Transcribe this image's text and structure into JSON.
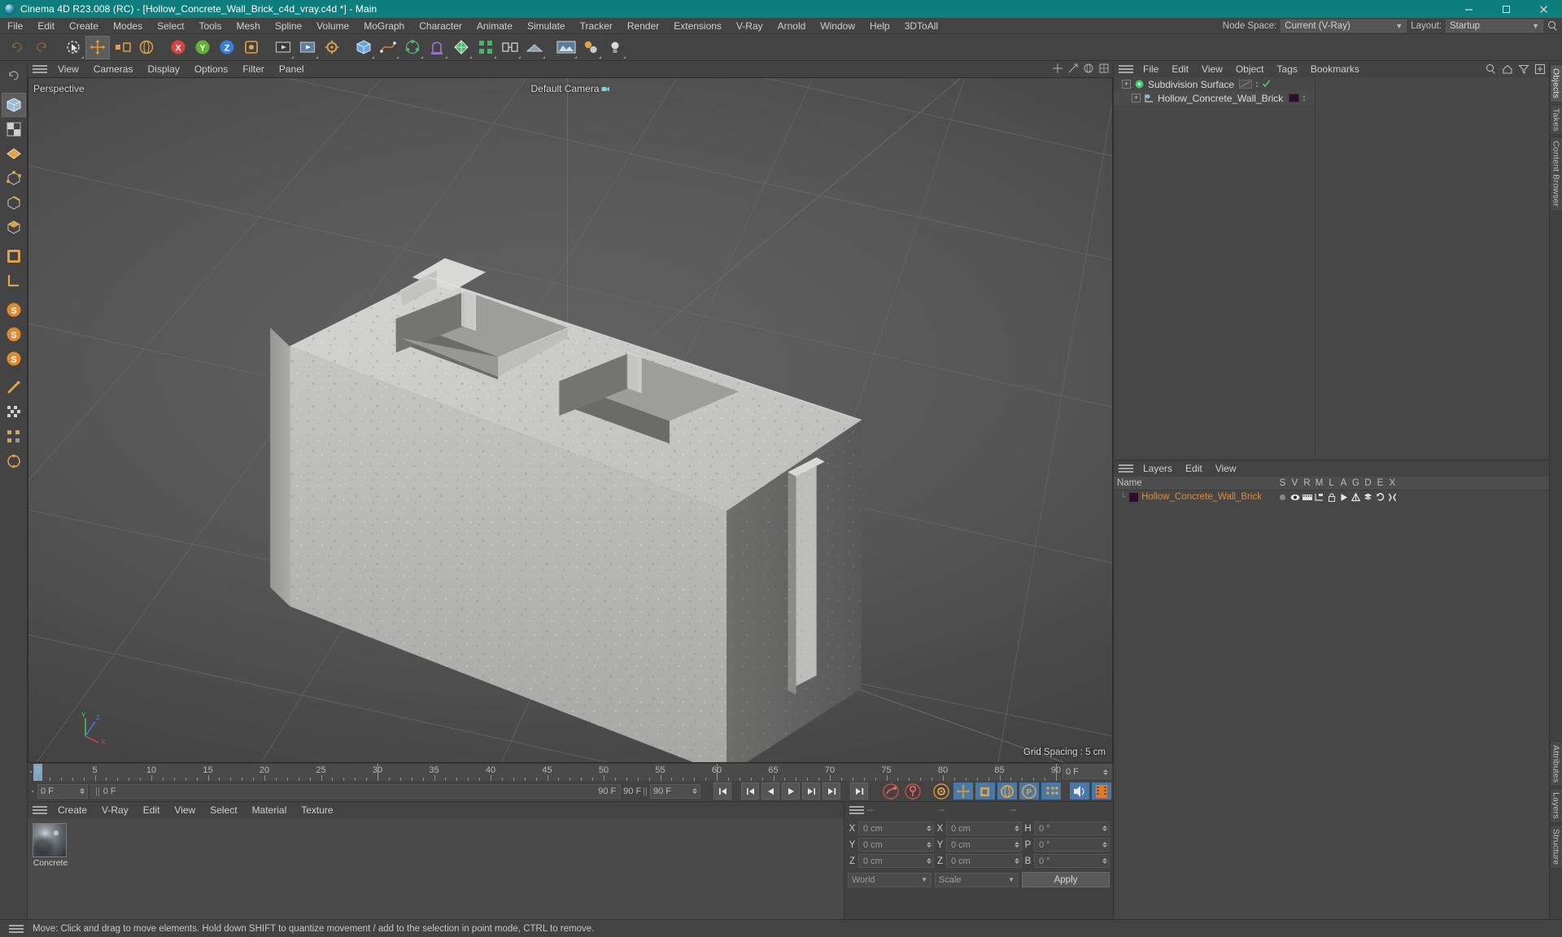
{
  "window": {
    "title": "Cinema 4D R23.008 (RC) - [Hollow_Concrete_Wall_Brick_c4d_vray.c4d *] - Main",
    "app_icon": "c4d-logo-icon",
    "minimize": "minimize-icon",
    "maximize": "maximize-icon",
    "close": "close-icon"
  },
  "menubar": {
    "items": [
      "File",
      "Edit",
      "Create",
      "Modes",
      "Select",
      "Tools",
      "Mesh",
      "Spline",
      "Volume",
      "MoGraph",
      "Character",
      "Animate",
      "Simulate",
      "Tracker",
      "Render",
      "Extensions",
      "V-Ray",
      "Arnold",
      "Window",
      "Help",
      "3DToAll"
    ],
    "node_space_label": "Node Space:",
    "node_space_value": "Current (V-Ray)",
    "layout_label": "Layout:",
    "layout_value": "Startup",
    "search_icon": "search-icon"
  },
  "toolbar": {
    "items": [
      {
        "name": "undo-button",
        "glyph": "undo"
      },
      {
        "name": "redo-button",
        "glyph": "redo"
      },
      {
        "name": "live-selection-tool",
        "glyph": "cursor"
      },
      {
        "name": "move-tool",
        "glyph": "move"
      },
      {
        "name": "scale-tool",
        "glyph": "scale"
      },
      {
        "name": "rotate-tool",
        "glyph": "rotate"
      },
      {
        "name": "transform-lock-button",
        "glyph": "lock"
      },
      {
        "name": "world-object-axis-button",
        "glyph": "axis"
      },
      {
        "name": "x-axis-lock",
        "glyph": "X"
      },
      {
        "name": "y-axis-lock",
        "glyph": "Y"
      },
      {
        "name": "z-axis-lock",
        "glyph": "Z"
      },
      {
        "name": "coordinate-system-button",
        "glyph": "world"
      },
      {
        "name": "render-view-button",
        "glyph": "render-view"
      },
      {
        "name": "render-to-picture-viewer-button",
        "glyph": "render-pv"
      },
      {
        "name": "render-settings-button",
        "glyph": "render-settings"
      },
      {
        "name": "cube-primitive-button",
        "glyph": "cube"
      },
      {
        "name": "spline-pen-button",
        "glyph": "spline"
      },
      {
        "name": "array-generator-button",
        "glyph": "array"
      },
      {
        "name": "bend-deformer-button",
        "glyph": "deformer"
      },
      {
        "name": "floor-environment-button",
        "glyph": "floor"
      },
      {
        "name": "camera-button",
        "glyph": "camera"
      },
      {
        "name": "light-button",
        "glyph": "light"
      }
    ]
  },
  "left_toolbar": {
    "items": [
      {
        "name": "point-mode-button",
        "glyph": "point"
      },
      {
        "name": "edge-mode-button",
        "glyph": "edge"
      },
      {
        "name": "polygon-mode-button",
        "glyph": "polygon"
      },
      {
        "name": "model-mode-button",
        "glyph": "model"
      },
      {
        "name": "object-mode-button",
        "glyph": "object"
      },
      {
        "name": "texture-mode-button",
        "glyph": "texture"
      },
      {
        "name": "workplane-mode-button",
        "glyph": "workplane"
      },
      {
        "name": "enable-axis-button",
        "glyph": "axis-l"
      },
      {
        "name": "viewport-solo-single-button",
        "glyph": "S"
      },
      {
        "name": "viewport-solo-hierarchy-button",
        "glyph": "S"
      },
      {
        "name": "viewport-solo-off-button",
        "glyph": "S"
      },
      {
        "name": "snap-button",
        "glyph": "magnet"
      },
      {
        "name": "quantize-button",
        "glyph": "quantize"
      },
      {
        "name": "workplane-lock-button",
        "glyph": "plane"
      },
      {
        "name": "parametric-snap-button",
        "glyph": "psnap"
      }
    ]
  },
  "viewport": {
    "menu_items": [
      "View",
      "Cameras",
      "Display",
      "Options",
      "Filter",
      "Panel"
    ],
    "hamburger_icon": "hamburger-icon",
    "panel_icons": [
      "move-viewport-icon",
      "scale-viewport-icon",
      "rotate-viewport-icon",
      "maximize-viewport-icon"
    ],
    "projection_label": "Perspective",
    "camera_label": "Default Camera",
    "camera_icon": "camera-icon",
    "grid_spacing_label": "Grid Spacing : 5 cm",
    "axis_gizmo": {
      "x": "X",
      "y": "Y",
      "z": "Z"
    }
  },
  "timeline": {
    "ticks": [
      {
        "label": "0",
        "frame": 0
      },
      {
        "label": "5",
        "frame": 5
      },
      {
        "label": "10",
        "frame": 10
      },
      {
        "label": "15",
        "frame": 15
      },
      {
        "label": "20",
        "frame": 20
      },
      {
        "label": "25",
        "frame": 25
      },
      {
        "label": "30",
        "frame": 30
      },
      {
        "label": "35",
        "frame": 35
      },
      {
        "label": "40",
        "frame": 40
      },
      {
        "label": "45",
        "frame": 45
      },
      {
        "label": "50",
        "frame": 50
      },
      {
        "label": "55",
        "frame": 55
      },
      {
        "label": "60",
        "frame": 60
      },
      {
        "label": "65",
        "frame": 65
      },
      {
        "label": "70",
        "frame": 70
      },
      {
        "label": "75",
        "frame": 75
      },
      {
        "label": "80",
        "frame": 80
      },
      {
        "label": "85",
        "frame": 85
      },
      {
        "label": "90",
        "frame": 90
      }
    ],
    "range_start": 0,
    "range_end": 90,
    "current_frame_field": "0 F",
    "current_frame_right": "0 F",
    "track_start_label": "0 F",
    "track_end_label": "90 F",
    "preview_end_field": "90 F",
    "preview_end_value": "90 F",
    "end_field": "90 F",
    "transport": [
      {
        "name": "go-to-start-button",
        "glyph": "start"
      },
      {
        "name": "previous-key-button",
        "glyph": "prevkey"
      },
      {
        "name": "play-backwards-button",
        "glyph": "playback"
      },
      {
        "name": "play-forwards-button",
        "glyph": "play"
      },
      {
        "name": "next-frame-button",
        "glyph": "nextframe"
      },
      {
        "name": "next-key-button",
        "glyph": "nextkey"
      },
      {
        "name": "go-to-end-button",
        "glyph": "end"
      }
    ],
    "record_tools": [
      {
        "name": "record-active-objects-button",
        "glyph": "record"
      },
      {
        "name": "autokeying-button",
        "glyph": "autokey"
      },
      {
        "name": "keyframe-selection-button",
        "glyph": "keyselect"
      },
      {
        "name": "position-key-button",
        "glyph": "pos"
      },
      {
        "name": "scale-key-button",
        "glyph": "scl"
      },
      {
        "name": "rotation-key-button",
        "glyph": "rot"
      },
      {
        "name": "parameter-key-button",
        "glyph": "param"
      },
      {
        "name": "point-level-animation-button",
        "glyph": "pla"
      },
      {
        "name": "play-sound-button",
        "glyph": "sound"
      },
      {
        "name": "timeline-button",
        "glyph": "film"
      }
    ]
  },
  "material_manager": {
    "menu_items": [
      "Create",
      "V-Ray",
      "Edit",
      "View",
      "Select",
      "Material",
      "Texture"
    ],
    "hamburger_icon": "hamburger-icon",
    "materials": [
      {
        "name": "Concrete",
        "preview": "sphere-preview"
      }
    ]
  },
  "coordinates": {
    "hamburger_icon": "hamburger-icon",
    "headers": [
      "--",
      "--",
      "--"
    ],
    "rows": [
      {
        "pos_axis": "X",
        "pos_value": "0 cm",
        "size_axis": "X",
        "size_value": "0 cm",
        "rot_axis": "H",
        "rot_value": "0 °"
      },
      {
        "pos_axis": "Y",
        "pos_value": "0 cm",
        "size_axis": "Y",
        "size_value": "0 cm",
        "rot_axis": "P",
        "rot_value": "0 °"
      },
      {
        "pos_axis": "Z",
        "pos_value": "0 cm",
        "size_axis": "Z",
        "size_value": "0 cm",
        "rot_axis": "B",
        "rot_value": "0 °"
      }
    ],
    "system_value": "World",
    "mode_value": "Scale",
    "apply_label": "Apply"
  },
  "object_manager": {
    "menu_items": [
      "File",
      "Edit",
      "View",
      "Object",
      "Tags",
      "Bookmarks"
    ],
    "hamburger_icon": "hamburger-icon",
    "header_icons": [
      "search-icon",
      "home-icon",
      "filter-icon",
      "add-layer-icon"
    ],
    "objects": [
      {
        "name": "Subdivision Surface",
        "icon": "subdivision-surface-icon",
        "indent": 0,
        "expanded": true,
        "has_tag_slot": true,
        "has_check": true
      },
      {
        "name": "Hollow_Concrete_Wall_Brick",
        "icon": "polygon-object-icon",
        "indent": 1,
        "expanded": true,
        "has_material": true,
        "material_color": "#2b0e2b"
      }
    ]
  },
  "layer_manager": {
    "menu_items": [
      "Layers",
      "Edit",
      "View"
    ],
    "hamburger_icon": "hamburger-icon",
    "columns": [
      "Name",
      "S",
      "V",
      "R",
      "M",
      "L",
      "A",
      "G",
      "D",
      "E",
      "X"
    ],
    "rows": [
      {
        "name": "Hollow_Concrete_Wall_Brick",
        "color": "#2b0e2b",
        "text_color": "#e08a3c",
        "flags": [
          "solo-dot-icon",
          "view-eye-icon",
          "render-icon",
          "manager-icon",
          "lock-icon",
          "animation-icon",
          "generators-icon",
          "deformers-icon",
          "expressions-icon",
          "xref-icon"
        ]
      }
    ]
  },
  "right_tabs": [
    {
      "label": "Objects",
      "active": true
    },
    {
      "label": "Takes",
      "active": false
    },
    {
      "label": "Content Browser",
      "active": false
    },
    {
      "label": "Attributes",
      "active": false
    },
    {
      "label": "Layers",
      "active": false
    },
    {
      "label": "Structure",
      "active": false
    }
  ],
  "statusbar": {
    "hamburger_icon": "hamburger-icon",
    "message": "Move: Click and drag to move elements. Hold down SHIFT to quantize movement / add to the selection in point mode, CTRL to remove."
  }
}
